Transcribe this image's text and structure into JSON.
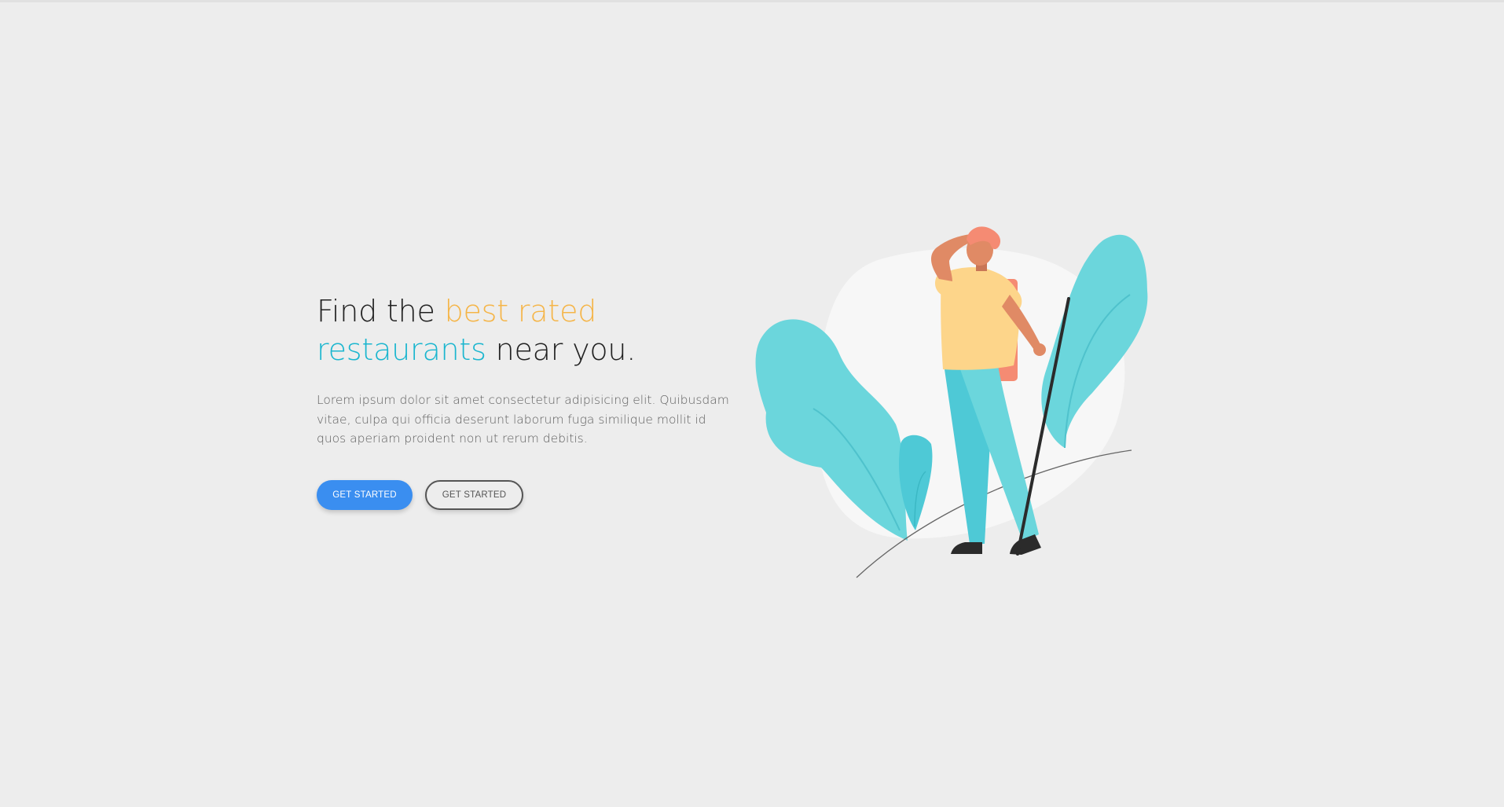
{
  "hero": {
    "headline": {
      "part1": "Find the ",
      "highlight1": "best rated",
      "highlight2": "restaurants",
      "part2": " near you."
    },
    "description": "Lorem ipsum dolor sit amet consectetur adipisicing elit. Quibusdam vitae, culpa qui officia deserunt laborum fuga similique mollit id quos aperiam proident non ut rerum debitis.",
    "primary_button": "GET STARTED",
    "secondary_button": "GET STARTED"
  },
  "illustration": {
    "subject": "hiker-illustration"
  },
  "colors": {
    "background": "#ededed",
    "accent_yellow": "#f5b548",
    "accent_teal": "#1bb6cf",
    "primary_button": "#3a8ef0",
    "leaf": "#6bd6dc",
    "pants": "#4ec9d6",
    "shirt": "#fdd58a",
    "skin": "#e08a65",
    "backpack": "#f58b73"
  }
}
